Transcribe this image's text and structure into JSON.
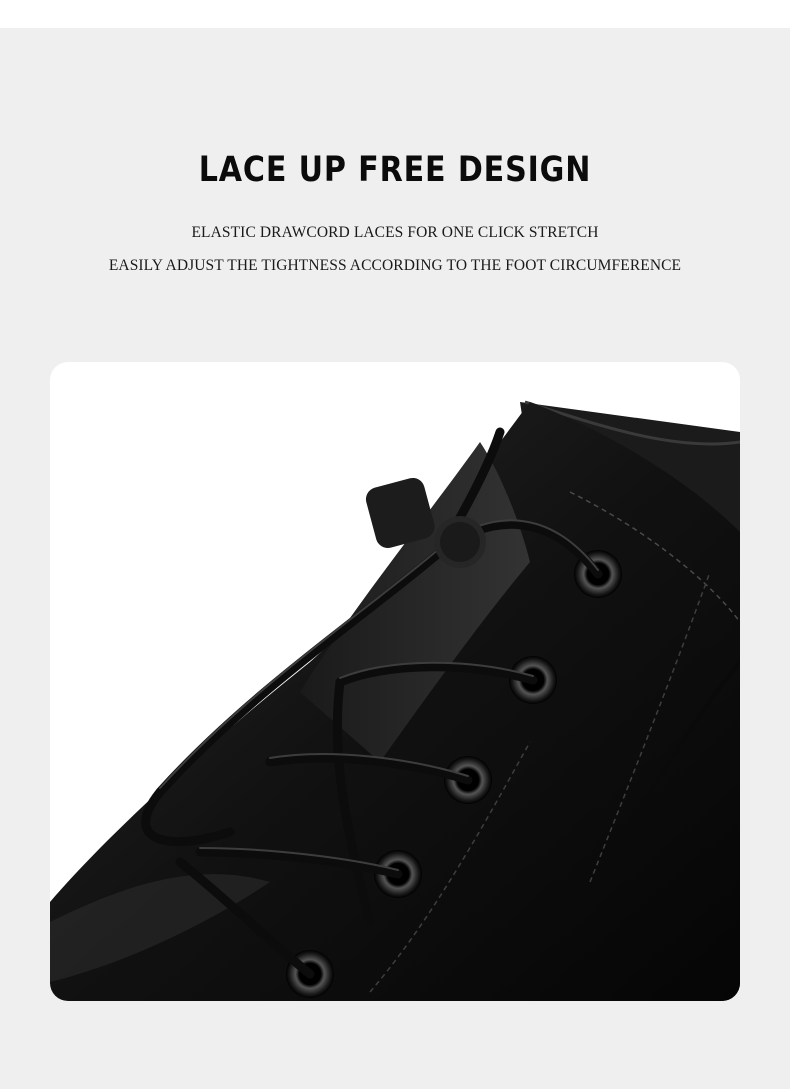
{
  "headline": "LACE UP FREE DESIGN",
  "subtitle_line_1": "ELASTIC DRAWCORD LACES FOR ONE CLICK STRETCH",
  "subtitle_line_2": "EASILY ADJUST THE TIGHTNESS ACCORDING TO THE FOOT CIRCUMFERENCE",
  "colors": {
    "page_background": "#efefef",
    "photo_background": "#ffffff",
    "leather": "#141414",
    "text": "#0b0b0b"
  }
}
